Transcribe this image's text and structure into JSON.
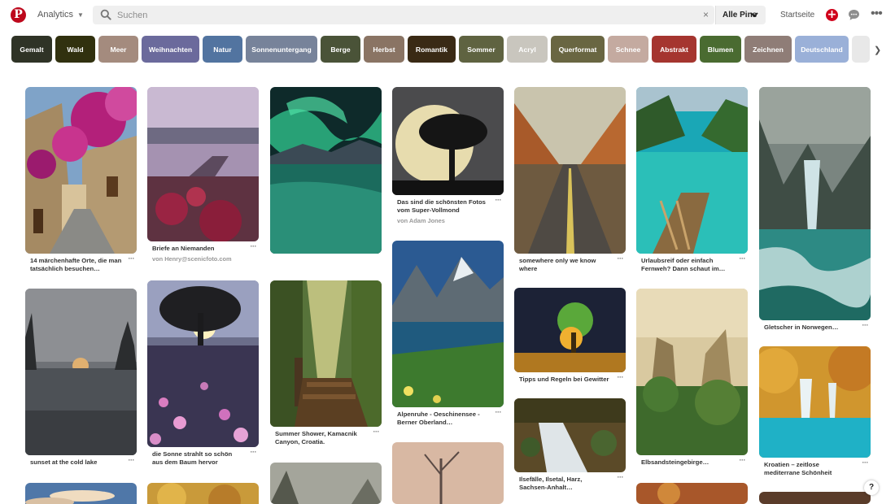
{
  "header": {
    "logo_glyph": "P",
    "nav_label": "Analytics",
    "search_placeholder": "Suchen",
    "clear_glyph": "×",
    "scope_label": "Alle Pins",
    "home_label": "Startseite",
    "plus_glyph": "+",
    "more_glyph": "•••"
  },
  "chips": [
    {
      "label": "Gemalt",
      "color": "#2f3326"
    },
    {
      "label": "Wald",
      "color": "#31310f"
    },
    {
      "label": "Meer",
      "color": "#a48b7e"
    },
    {
      "label": "Weihnachten",
      "color": "#6b6a9c"
    },
    {
      "label": "Natur",
      "color": "#5274a0"
    },
    {
      "label": "Sonnenuntergang",
      "color": "#77839a"
    },
    {
      "label": "Berge",
      "color": "#4a5338"
    },
    {
      "label": "Herbst",
      "color": "#8a7464"
    },
    {
      "label": "Romantik",
      "color": "#3a2a15"
    },
    {
      "label": "Sommer",
      "color": "#5f6341"
    },
    {
      "label": "Acryl",
      "color": "#c9c6be"
    },
    {
      "label": "Querformat",
      "color": "#696642"
    },
    {
      "label": "Schnee",
      "color": "#c4aaa0"
    },
    {
      "label": "Abstrakt",
      "color": "#a5352f"
    },
    {
      "label": "Blumen",
      "color": "#4a6b31"
    },
    {
      "label": "Zeichnen",
      "color": "#8f7d77"
    },
    {
      "label": "Deutschland",
      "color": "#9ab0d8"
    },
    {
      "label": "",
      "color": "#e8e8e8"
    }
  ],
  "pins": [
    {
      "caption": "14 märchenhafte Orte, die man tatsächlich besuchen…",
      "byline": ""
    },
    {
      "caption": "sunset at the cold lake",
      "byline": ""
    },
    {
      "caption": "Briefe an Niemanden",
      "byline": "von Henry@scenicfoto.com"
    },
    {
      "caption": "die Sonne strahlt so schön aus dem Baum hervor",
      "byline": ""
    },
    {
      "caption": "",
      "byline": ""
    },
    {
      "caption": "Summer Shower, Kamacnik Canyon, Croatia.",
      "byline": ""
    },
    {
      "caption": "Das sind die schönsten Fotos vom Super-Vollmond",
      "byline": "von Adam Jones"
    },
    {
      "caption": "Alpenruhe - Oeschinensee - Berner Oberland…",
      "byline": ""
    },
    {
      "caption": "somewhere only we know where",
      "byline": ""
    },
    {
      "caption": "Tipps und Regeln bei Gewitter",
      "byline": ""
    },
    {
      "caption": "Ilsefälle, Ilsetal, Harz, Sachsen-Anhalt…",
      "byline": ""
    },
    {
      "caption": "Urlaubsreif oder einfach Fernweh? Dann schaut im…",
      "byline": ""
    },
    {
      "caption": "Elbsandsteingebirge…",
      "byline": ""
    },
    {
      "caption": "Gletscher in Norwegen…",
      "byline": ""
    },
    {
      "caption": "Kroatien – zeitlose mediterrane Schönheit",
      "byline": ""
    }
  ],
  "pin_menu_glyph": "···",
  "help_glyph": "?"
}
